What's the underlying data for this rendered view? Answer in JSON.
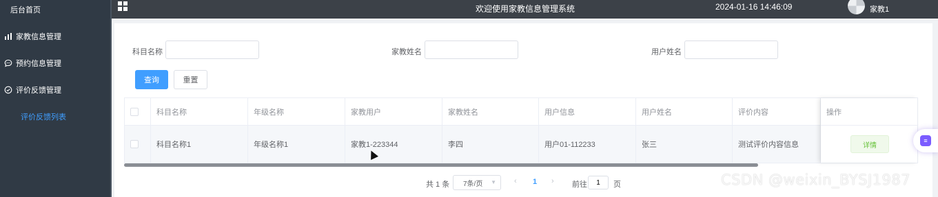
{
  "sidebar": {
    "home": "后台首页",
    "items": [
      {
        "label": "家教信息管理",
        "icon": "bar-chart-icon"
      },
      {
        "label": "预约信息管理",
        "icon": "chat-bubble-icon"
      },
      {
        "label": "评价反馈管理",
        "icon": "check-circle-icon"
      }
    ],
    "active_sub": "评价反馈列表"
  },
  "header": {
    "menu_icon": "grid-icon",
    "title": "欢迎使用家教信息管理系统",
    "datetime": "2024-01-16 14:46:09",
    "user": "家教1"
  },
  "filters": [
    {
      "label": "科目名称",
      "value": ""
    },
    {
      "label": "家教姓名",
      "value": ""
    },
    {
      "label": "用户姓名",
      "value": ""
    }
  ],
  "buttons": {
    "search": "查询",
    "reset": "重置"
  },
  "table": {
    "headers": [
      "科目名称",
      "年级名称",
      "家教用户",
      "家教姓名",
      "用户信息",
      "用户姓名",
      "评价内容",
      "操作"
    ],
    "rows": [
      {
        "cells": [
          "科目名称1",
          "年级名称1",
          "家教1-223344",
          "李四",
          "用户01-112233",
          "张三",
          "测试评价内容信息"
        ],
        "action": "详情"
      }
    ]
  },
  "pagination": {
    "total": "共 1 条",
    "page_size": "7条/页",
    "prev": "‹",
    "current": "1",
    "next": "›",
    "goto_label": "前往",
    "goto_value": "1",
    "page_unit": "页"
  },
  "watermark": "CSDN @weixin_BYSJ1987"
}
